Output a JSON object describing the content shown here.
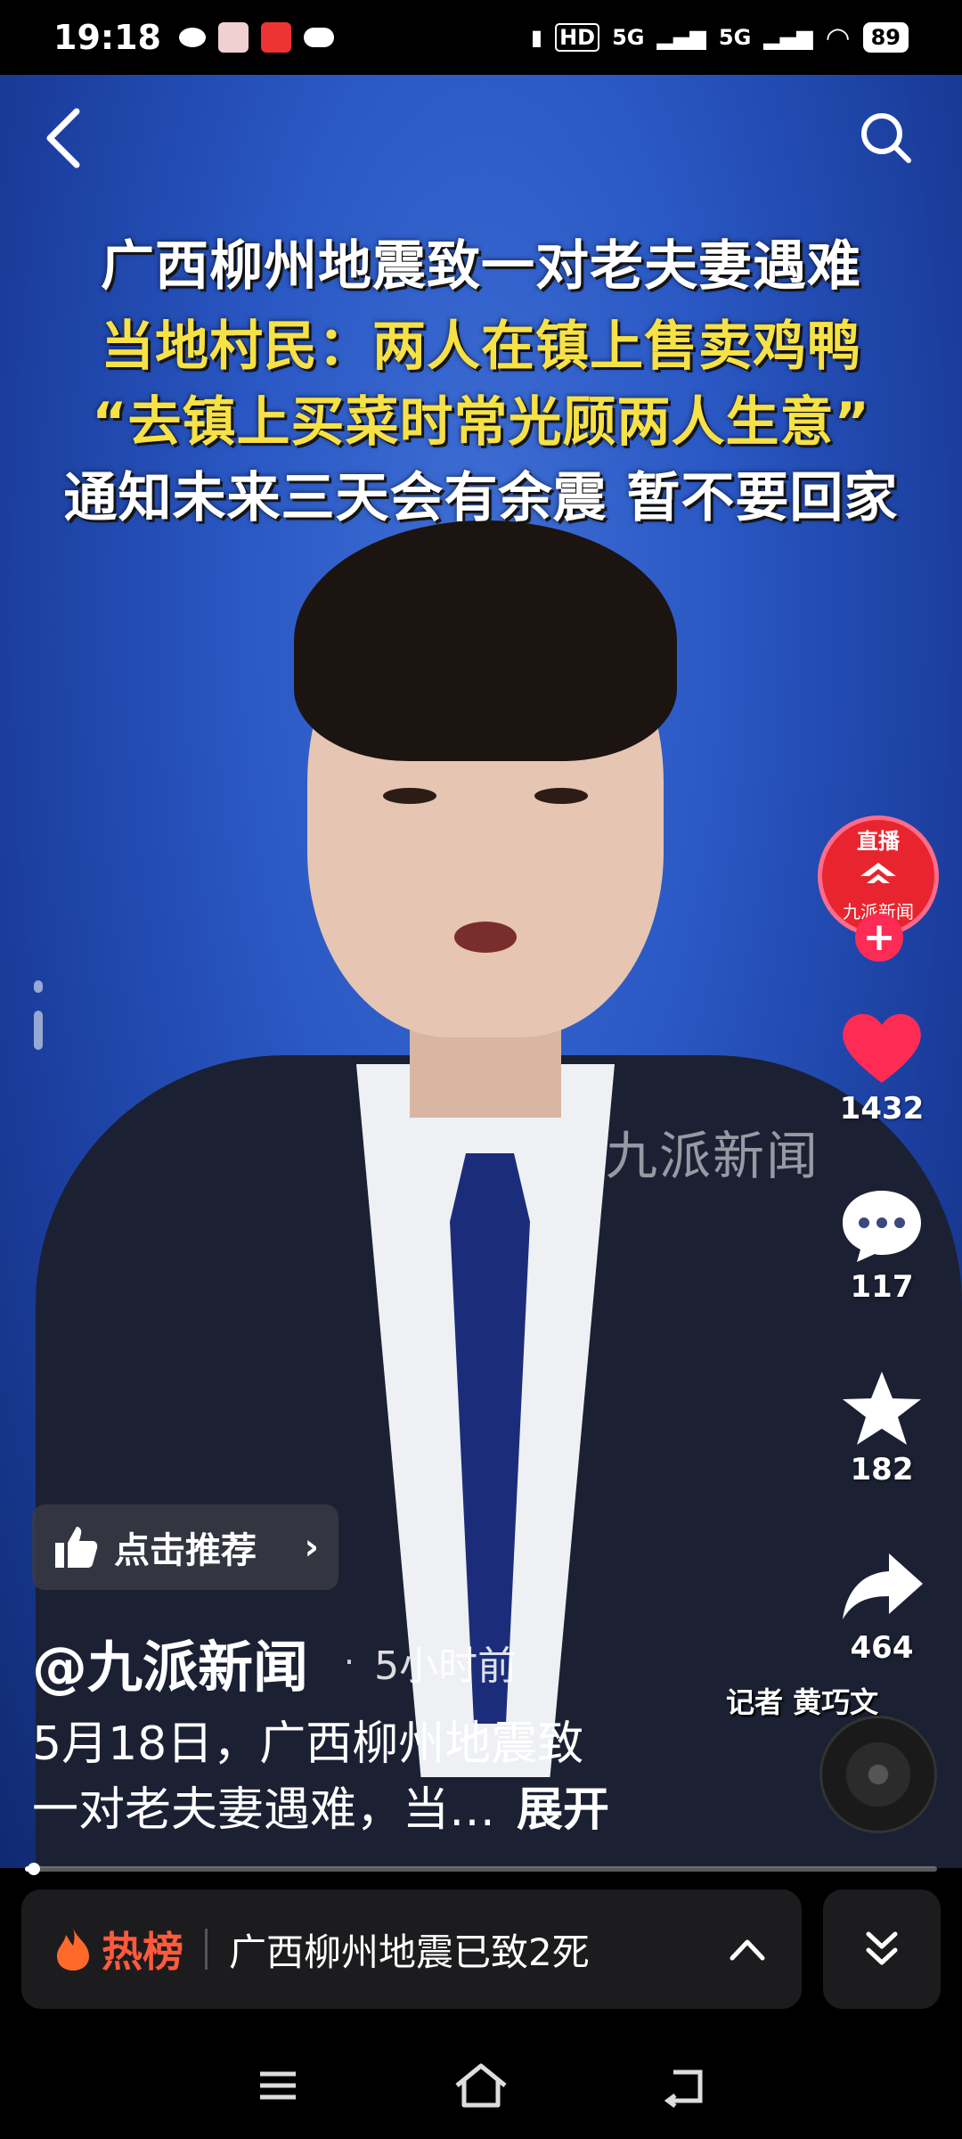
{
  "status": {
    "time": "19:18",
    "battery": "89",
    "network_1": "5G",
    "network_2": "5G",
    "hd": "HD"
  },
  "video": {
    "headline": [
      "广西柳州地震致一对老夫妻遇难",
      "当地村民：两人在镇上售卖鸡鸭",
      "“去镇上买菜时常光顾两人生意”",
      "通知未来三天会有余震 暂不要回家"
    ],
    "watermark": "九派新闻",
    "reporter": "记者 黄巧文"
  },
  "rail": {
    "live_label": "直播",
    "live_name": "九派新闻",
    "likes": "1432",
    "comments": "117",
    "favorites": "182",
    "shares": "464"
  },
  "post": {
    "recommend_label": "点击推荐",
    "author": "@九派新闻",
    "time_sep": "·",
    "time": "5小时前",
    "caption_line1": "5月18日，广西柳州地震致",
    "caption_line2": "一对老夫妻遇难，当…",
    "expand": "展开",
    "progress": 0.01
  },
  "hot": {
    "tag": "热榜",
    "text": "广西柳州地震已致2死"
  },
  "colors": {
    "like": "#fe2c55",
    "hot": "#ff5a3c",
    "background": "#2a58c4"
  }
}
